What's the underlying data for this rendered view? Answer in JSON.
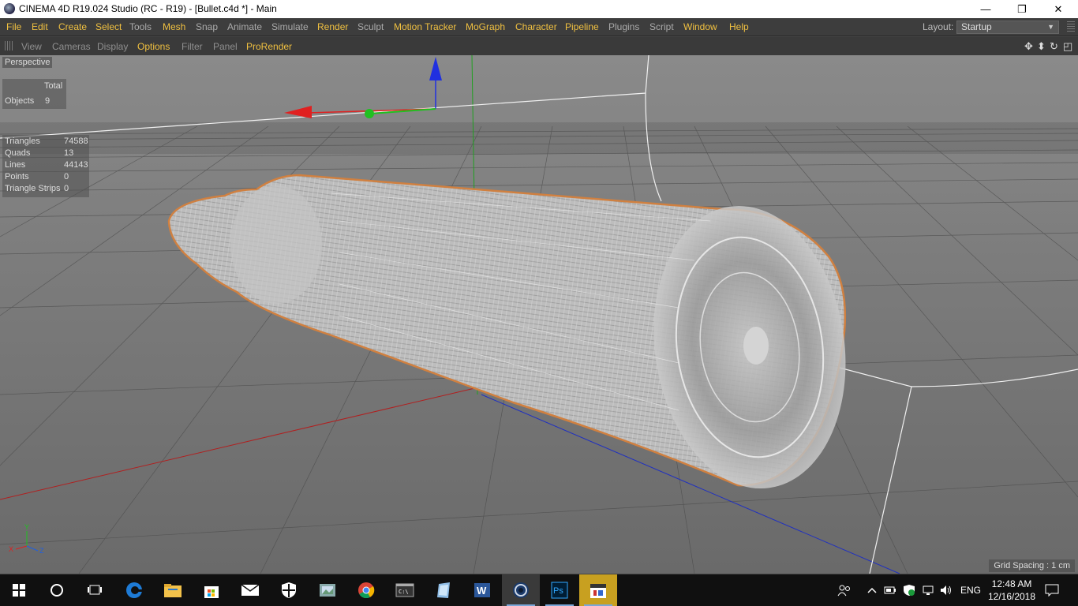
{
  "window": {
    "title": "CINEMA 4D R19.024 Studio (RC - R19) - [Bullet.c4d *] - Main",
    "minimize": "—",
    "maximize": "❐",
    "close": "✕"
  },
  "menu": {
    "items": [
      "File",
      "Edit",
      "Create",
      "Select",
      "Tools",
      "Mesh",
      "Snap",
      "Animate",
      "Simulate",
      "Render",
      "Sculpt",
      "Motion Tracker",
      "MoGraph",
      "Character",
      "Pipeline",
      "Plugins",
      "Script",
      "Window",
      "Help"
    ],
    "layout_label": "Layout:",
    "layout_value": "Startup"
  },
  "viewport_menu": {
    "items": [
      "View",
      "Cameras",
      "Display",
      "Options",
      "Filter",
      "Panel",
      "ProRender"
    ]
  },
  "viewport": {
    "camera_label": "Perspective",
    "stats_header": "Total",
    "objects_label": "Objects",
    "objects_value": "9",
    "triangles_label": "Triangles",
    "triangles_value": "74588",
    "quads_label": "Quads",
    "quads_value": "13",
    "lines_label": "Lines",
    "lines_value": "44143",
    "points_label": "Points",
    "points_value": "0",
    "strips_label": "Triangle Strips",
    "strips_value": "0",
    "grid_spacing": "Grid Spacing : 1 cm",
    "axis_y": "Y",
    "axis_x": "X",
    "axis_z": "Z"
  },
  "taskbar": {
    "language": "ENG",
    "time": "12:48 AM",
    "date": "12/16/2018"
  },
  "colors": {
    "menu_highlight": "#f0c040",
    "object_outline": "#d08040",
    "axis_x": "#e02020",
    "axis_y": "#20c020",
    "axis_z": "#2040e0"
  }
}
